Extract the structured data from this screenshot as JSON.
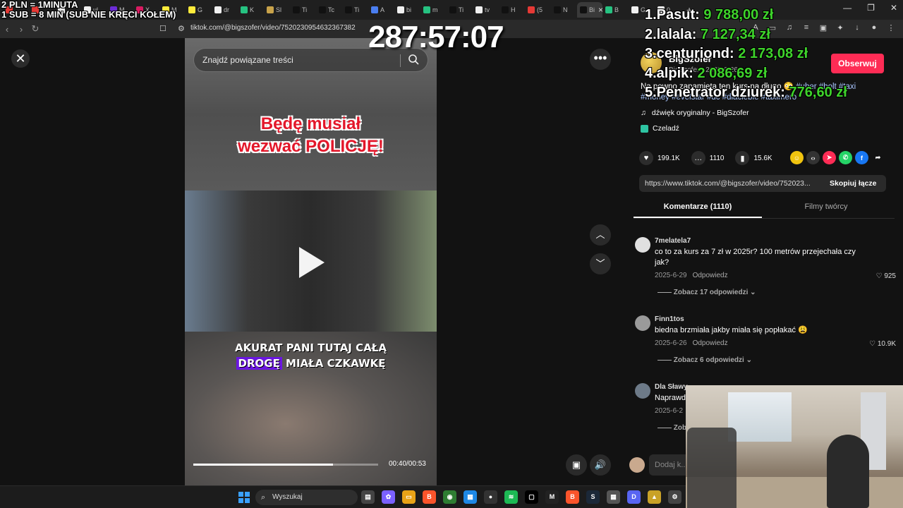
{
  "overlay": {
    "donate_line1": "2 PLN = 1MINUTA",
    "donate_line2": "1 SUB = 8 MIN (SUB NIE KRĘCI KOŁEM)",
    "timer": "287:57:07",
    "leaderboard": [
      {
        "name": "1.Pasut:",
        "amount": "9 788,00 zł"
      },
      {
        "name": "2.lalala:",
        "amount": "7 127,34 zł"
      },
      {
        "name": "3.centuriond:",
        "amount": "2 173,08 zł"
      },
      {
        "name": "4.alpik:",
        "amount": "2 086,69 zł"
      },
      {
        "name": "5.Penetrator dziurek:",
        "amount": "776,60 zł"
      }
    ]
  },
  "browser": {
    "tabs": [
      {
        "label": "",
        "color": "#e53935"
      },
      {
        "label": "",
        "color": "#e53935"
      },
      {
        "label": "",
        "color": "#f0f0f0"
      },
      {
        "label": "ul",
        "color": "#f0f0f0"
      },
      {
        "label": "M",
        "color": "#6c2cd6"
      },
      {
        "label": "X",
        "color": "#d81b60"
      },
      {
        "label": "M",
        "color": "#ffeb3b"
      },
      {
        "label": "G",
        "color": "#ffeb3b"
      },
      {
        "label": "dr",
        "color": "#f0f0f0"
      },
      {
        "label": "K",
        "color": "#26c281"
      },
      {
        "label": "Sl",
        "color": "#c8a24a"
      },
      {
        "label": "Ti",
        "color": "#111111"
      },
      {
        "label": "Tc",
        "color": "#111111"
      },
      {
        "label": "Ti",
        "color": "#111111"
      },
      {
        "label": "A",
        "color": "#4a7ef0"
      },
      {
        "label": "bi",
        "color": "#f0f0f0"
      },
      {
        "label": "m",
        "color": "#26c281"
      },
      {
        "label": "Ti",
        "color": "#111111"
      },
      {
        "label": "tv",
        "color": "#f0f0f0"
      },
      {
        "label": "H",
        "color": "#111111"
      },
      {
        "label": "(5",
        "color": "#e53935"
      },
      {
        "label": "N",
        "color": "#111111"
      },
      {
        "label": "Bi",
        "color": "#111111"
      },
      {
        "label": "B",
        "color": "#26c281"
      },
      {
        "label": "G",
        "color": "#f0f0f0"
      },
      {
        "label": "0.",
        "color": "#f0f0f0"
      }
    ],
    "new_tab": "+",
    "minimize": "—",
    "maximize": "❐",
    "close": "✕",
    "url": "tiktok.com/@bigszofer/video/7520230954632367382"
  },
  "video": {
    "search_placeholder": "Znajdź powiązane treści",
    "caption_red_line1": "Będę musiał",
    "caption_red_line2": "wezwać POLICJĘ!",
    "caption_white_line1": "AKURAT PANI TUTAJ CAŁĄ",
    "caption_white_hl": "DROGĘ",
    "caption_white_line2_rest": "MIAŁA CZKAWKĘ",
    "progress_fraction": 0.755,
    "time": "00:40/00:53"
  },
  "panel": {
    "username": "BigSzofer",
    "user_date": "BigSzofer · 2025-6-26",
    "follow_label": "Obserwuj",
    "description_text": "Na pewno zapamięta ten kurs na długo 😳 ",
    "description_tags": "#uber #bolt #taxi #money #evelstar #dc #dlaciebie #taximero",
    "sound": "dźwięk oryginalny - BigSzofer",
    "place": "Czeladź",
    "likes": "199.1K",
    "comments": "1110",
    "saves": "15.6K",
    "share_url": "https://www.tiktok.com/@bigszofer/video/752023...",
    "copy_link": "Skopiuj łącze",
    "tab_comments": "Komentarze (1110)",
    "tab_creator": "Filmy twórcy",
    "add_comment_placeholder": "Dodaj k..."
  },
  "comments": [
    {
      "user": "7melatela7",
      "text": "co to za kurs za 7 zł w 2025r? 100 metrów przejechała czy jak?",
      "date": "2025-6-29",
      "reply": "Odpowiedz",
      "likes": "925",
      "more": "Zobacz 17 odpowiedzi"
    },
    {
      "user": "Finn1tos",
      "text": "biedna brzmiała jakby miała się popłakać 😩",
      "date": "2025-6-26",
      "reply": "Odpowiedz",
      "likes": "10.9K",
      "more": "Zobacz 6 odpowiedzi"
    },
    {
      "user": "Dla Sławy",
      "text": "Naprawd",
      "date": "2025-6-2",
      "reply": "",
      "likes": "",
      "more": "Zob"
    }
  ],
  "taskbar": {
    "search_label": "Wyszukaj"
  }
}
